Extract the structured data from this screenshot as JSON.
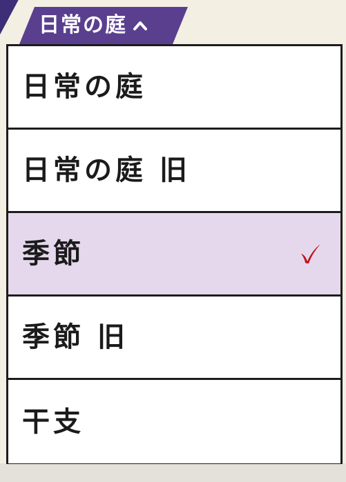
{
  "header": {
    "title": "日常の庭",
    "icon": "chevron-up-icon",
    "color": "#5a3f8f"
  },
  "options": [
    {
      "label": "日常の庭",
      "selected": false
    },
    {
      "label": "日常の庭 旧",
      "selected": false
    },
    {
      "label": "季節",
      "selected": true
    },
    {
      "label": "季節 旧",
      "selected": false
    },
    {
      "label": "干支",
      "selected": false
    }
  ],
  "colors": {
    "selected_background": "#e5d8ec",
    "check_mark": "#c0151c",
    "border": "#1c1c1c",
    "page_background": "#f3efe3"
  }
}
